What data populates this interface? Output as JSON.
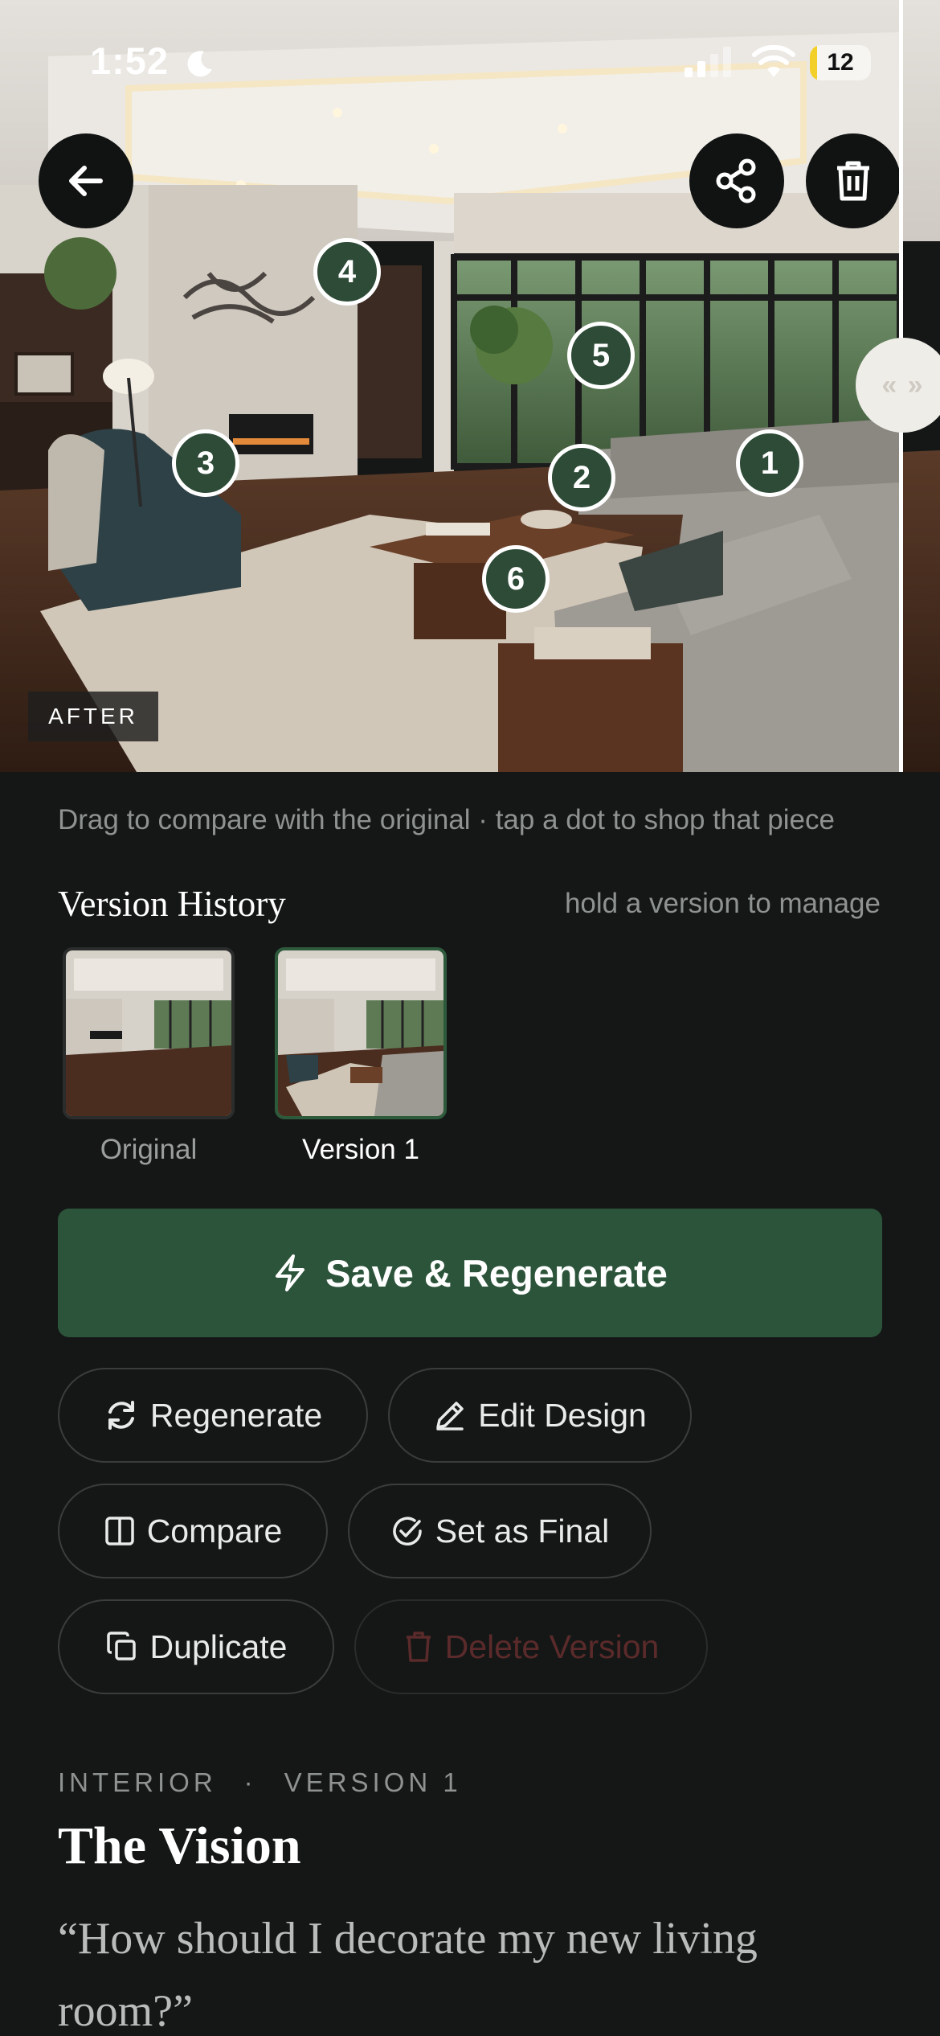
{
  "status_bar": {
    "time": "1:52",
    "battery": "12",
    "battery_level": 0.12
  },
  "hero": {
    "tag": "AFTER",
    "hotspots": [
      "1",
      "2",
      "3",
      "4",
      "5",
      "6"
    ],
    "compare_handle": "« »"
  },
  "hint": "Drag to compare with the original · tap a dot to shop that piece",
  "version_history": {
    "title": "Version History",
    "hint": "hold a version to manage",
    "items": [
      {
        "label": "Original",
        "selected": false
      },
      {
        "label": "Version 1",
        "selected": true
      }
    ]
  },
  "actions": {
    "primary": "Save & Regenerate",
    "regenerate": "Regenerate",
    "edit": "Edit Design",
    "compare": "Compare",
    "set_final": "Set as Final",
    "duplicate": "Duplicate",
    "delete": "Delete Version"
  },
  "details": {
    "category": "INTERIOR",
    "separator": "·",
    "version": "VERSION 1",
    "title": "The Vision",
    "quote": "“How should I decorate my new living room?”"
  },
  "colors": {
    "accent": "#2c543a",
    "background": "#151717",
    "danger_disabled": "#5b2a2a"
  },
  "icons": [
    "back-arrow-icon",
    "share-icon",
    "trash-icon",
    "moon-icon",
    "signal-icon",
    "wifi-icon",
    "bolt-icon",
    "refresh-icon",
    "pencil-icon",
    "compare-icon",
    "check-circle-icon",
    "duplicate-icon"
  ]
}
